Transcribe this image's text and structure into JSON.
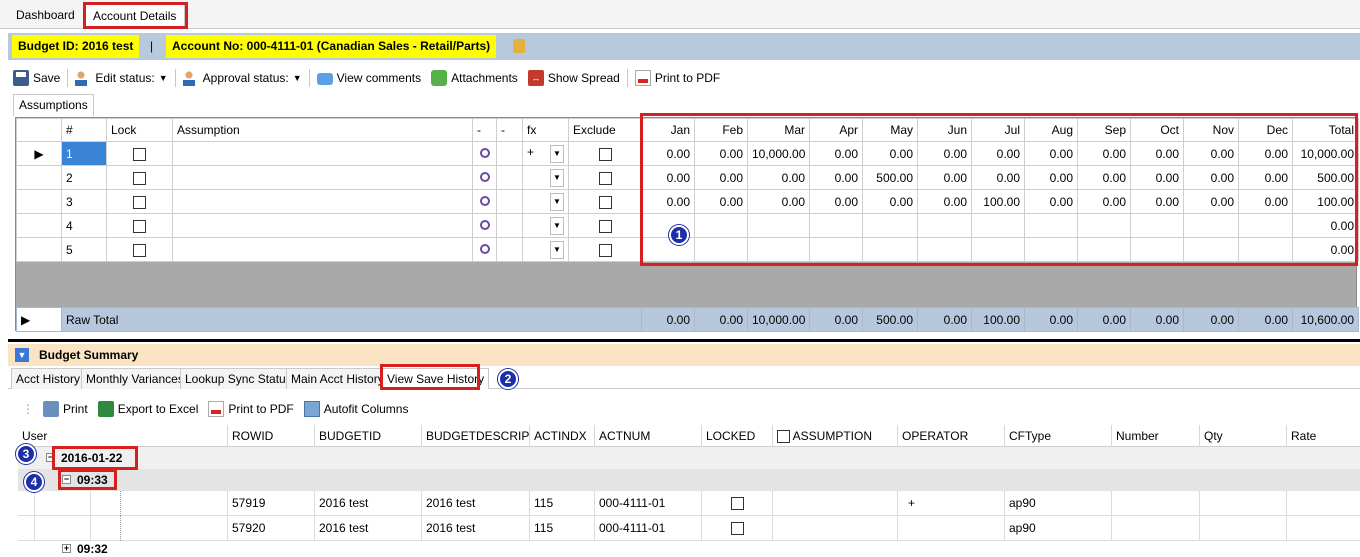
{
  "top_tabs": [
    "Dashboard",
    "Account Details"
  ],
  "header": {
    "budget_id": "Budget ID: 2016 test",
    "separator": "|",
    "account_no": "Account No: 000-4111-01 (Canadian Sales - Retail/Parts)"
  },
  "toolbar": {
    "save": "Save",
    "edit_status": "Edit status:",
    "approval_status": "Approval status:",
    "view_comments": "View comments",
    "attachments": "Attachments",
    "show_spread": "Show Spread",
    "print_pdf": "Print to PDF"
  },
  "assumptions_tab": "Assumptions",
  "grid": {
    "headers": [
      "#",
      "Lock",
      "Assumption",
      "-",
      "-",
      "fx",
      "Exclude",
      "Jan",
      "Feb",
      "Mar",
      "Apr",
      "May",
      "Jun",
      "Jul",
      "Aug",
      "Sep",
      "Oct",
      "Nov",
      "Dec",
      "Total"
    ],
    "rows": [
      {
        "num": "1",
        "fx": "+",
        "months": [
          "0.00",
          "0.00",
          "10,000.00",
          "0.00",
          "0.00",
          "0.00",
          "0.00",
          "0.00",
          "0.00",
          "0.00",
          "0.00",
          "0.00"
        ],
        "total": "10,000.00"
      },
      {
        "num": "2",
        "fx": "",
        "months": [
          "0.00",
          "0.00",
          "0.00",
          "0.00",
          "500.00",
          "0.00",
          "0.00",
          "0.00",
          "0.00",
          "0.00",
          "0.00",
          "0.00"
        ],
        "total": "500.00"
      },
      {
        "num": "3",
        "fx": "",
        "months": [
          "0.00",
          "0.00",
          "0.00",
          "0.00",
          "0.00",
          "0.00",
          "100.00",
          "0.00",
          "0.00",
          "0.00",
          "0.00",
          "0.00"
        ],
        "total": "100.00"
      },
      {
        "num": "4",
        "fx": "",
        "months": [
          "",
          "",
          "",
          "",
          "",
          "",
          "",
          "",
          "",
          "",
          "",
          ""
        ],
        "total": "0.00"
      },
      {
        "num": "5",
        "fx": "",
        "months": [
          "",
          "",
          "",
          "",
          "",
          "",
          "",
          "",
          "",
          "",
          "",
          ""
        ],
        "total": "0.00"
      }
    ],
    "raw_total": {
      "label": "Raw Total",
      "months": [
        "0.00",
        "0.00",
        "10,000.00",
        "0.00",
        "500.00",
        "0.00",
        "100.00",
        "0.00",
        "0.00",
        "0.00",
        "0.00",
        "0.00"
      ],
      "total": "10,600.00"
    }
  },
  "badges": [
    "1",
    "2",
    "3",
    "4"
  ],
  "budget_summary": {
    "title": "Budget Summary",
    "tabs": [
      "Acct History",
      "Monthly Variances",
      "Lookup Sync Status",
      "Main Acct History",
      "View Save History"
    ],
    "toolbar": {
      "print": "Print",
      "export_excel": "Export to Excel",
      "print_pdf": "Print to PDF",
      "autofit": "Autofit Columns"
    },
    "columns": [
      "User",
      "ROWID",
      "BUDGETID",
      "BUDGETDESCRIP",
      "ACTINDX",
      "ACTNUM",
      "LOCKED",
      "ASSUMPTION",
      "OPERATOR",
      "CFType",
      "Number",
      "Qty",
      "Rate"
    ],
    "group_date": "2016-01-22",
    "group_time": "09:33",
    "group_time_next": "09:32",
    "rows": [
      {
        "rowid": "57919",
        "budgetid": "2016 test",
        "descrip": "2016 test",
        "actindx": "115",
        "actnum": "000-4111-01",
        "operator": "+",
        "cftype": "ap90"
      },
      {
        "rowid": "57920",
        "budgetid": "2016 test",
        "descrip": "2016 test",
        "actindx": "115",
        "actnum": "000-4111-01",
        "operator": "",
        "cftype": "ap90"
      }
    ]
  }
}
